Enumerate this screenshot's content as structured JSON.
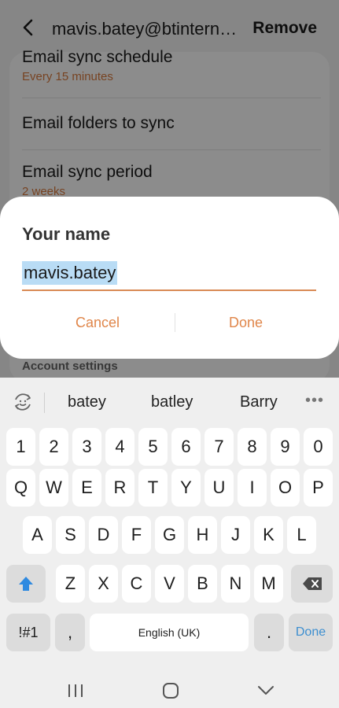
{
  "header": {
    "account_title": "mavis.batey@btintern…",
    "remove_label": "Remove"
  },
  "settings": {
    "rows": [
      {
        "title": "Email sync schedule",
        "subtitle": "Every 15 minutes"
      },
      {
        "title": "Email folders to sync",
        "subtitle": ""
      },
      {
        "title": "Email sync period",
        "subtitle": "2 weeks"
      }
    ],
    "section_header": "Account settings"
  },
  "dialog": {
    "title": "Your name",
    "input_value": "mavis.batey",
    "cancel_label": "Cancel",
    "done_label": "Done"
  },
  "keyboard": {
    "suggestions": [
      "batey",
      "batley",
      "Barry"
    ],
    "more_label": "•••",
    "number_row": [
      "1",
      "2",
      "3",
      "4",
      "5",
      "6",
      "7",
      "8",
      "9",
      "0"
    ],
    "row1": [
      "Q",
      "W",
      "E",
      "R",
      "T",
      "Y",
      "U",
      "I",
      "O",
      "P"
    ],
    "row2": [
      "A",
      "S",
      "D",
      "F",
      "G",
      "H",
      "J",
      "K",
      "L"
    ],
    "row3": [
      "Z",
      "X",
      "C",
      "V",
      "B",
      "N",
      "M"
    ],
    "symbols_label": "!#1",
    "comma_label": ",",
    "space_label": "English (UK)",
    "period_label": ".",
    "enter_label": "Done"
  },
  "colors": {
    "accent": "#e0864a",
    "subtitle": "#d97b3e",
    "selection": "#b9dcf5",
    "enter_key_text": "#3d8fd0"
  },
  "icons": {
    "back": "chevron-left-icon",
    "suggestion_mode": "emoji-refresh-icon",
    "shift": "shift-arrow-icon",
    "backspace": "backspace-icon",
    "nav_recents": "recents-icon",
    "nav_home": "home-icon",
    "nav_back": "chevron-down-icon"
  }
}
